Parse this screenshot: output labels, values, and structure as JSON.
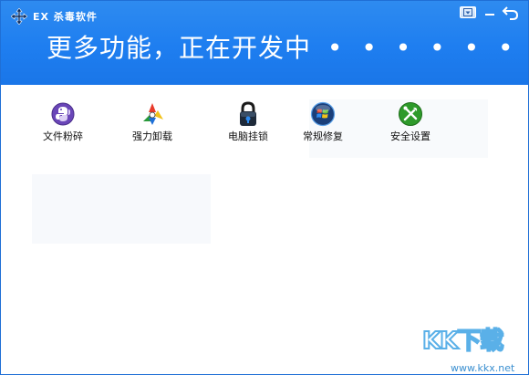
{
  "window": {
    "title": "EX 杀毒软件",
    "app_icon": "move-arrows-icon",
    "controls": {
      "menu": "menu-dropdown-icon",
      "minimize": "minimize-icon",
      "back": "back-arrow-icon"
    }
  },
  "banner": {
    "text": "更多功能，正在开发中",
    "dots": "• • • • • • •"
  },
  "tools": [
    {
      "label": "文件粉碎",
      "icon": "python-icon"
    },
    {
      "label": "强力卸载",
      "icon": "colorful-swirl-icon"
    },
    {
      "label": "电脑挂锁",
      "icon": "padlock-icon"
    },
    {
      "label": "常规修复",
      "icon": "windows-orb-icon"
    },
    {
      "label": "安全设置",
      "icon": "green-tools-icon"
    }
  ],
  "watermark": {
    "logo": "KK下载",
    "url": "www.kkx.net"
  },
  "colors": {
    "header": "#1e7ef0",
    "border": "#1f6fd6",
    "background": "#ffffff"
  }
}
